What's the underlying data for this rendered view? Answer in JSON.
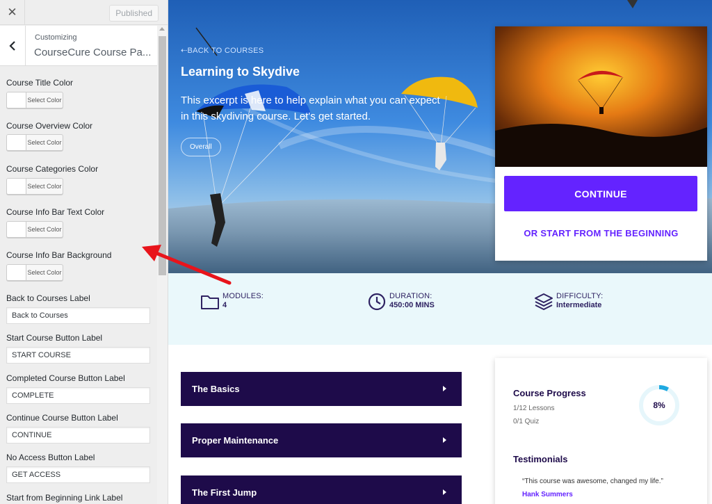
{
  "sidebar": {
    "close_icon": "close-icon",
    "published_label": "Published",
    "back_icon": "chevron-left-icon",
    "subtitle": "Customizing",
    "title": "CourseCure Course Pa...",
    "select_color_label": "Select Color",
    "color_controls": [
      {
        "label": "Course Title Color"
      },
      {
        "label": "Course Overview Color"
      },
      {
        "label": "Course Categories Color"
      },
      {
        "label": "Course Info Bar Text Color"
      },
      {
        "label": "Course Info Bar Background"
      }
    ],
    "text_controls": [
      {
        "label": "Back to Courses Label",
        "value": "Back to Courses"
      },
      {
        "label": "Start Course Button Label",
        "value": "START COURSE"
      },
      {
        "label": "Completed Course Button Label",
        "value": "COMPLETE"
      },
      {
        "label": "Continue Course Button Label",
        "value": "CONTINUE"
      },
      {
        "label": "No Access Button Label",
        "value": "GET ACCESS"
      },
      {
        "label": "Start from Beginning Link Label",
        "value": ""
      }
    ]
  },
  "hero": {
    "back_link": "BACK TO COURSES",
    "title": "Learning to Skydive",
    "excerpt": "This excerpt is here to help explain what you can expect in this skydiving course. Let's get started.",
    "pill": "Overall"
  },
  "card": {
    "continue_label": "CONTINUE",
    "restart_label": "OR START FROM THE BEGINNING"
  },
  "info_bar": {
    "modules_label": "MODULES:",
    "modules_value": "4",
    "duration_label": "DURATION:",
    "duration_value": "450:00 MINS",
    "difficulty_label": "DIFFICULTY:",
    "difficulty_value": "Intermediate"
  },
  "modules": [
    {
      "title": "The Basics"
    },
    {
      "title": "Proper Maintenance"
    },
    {
      "title": "The First Jump"
    }
  ],
  "progress": {
    "title": "Course Progress",
    "lessons": "1/12 Lessons",
    "quiz": "0/1 Quiz",
    "percent_label": "8%",
    "percent": 0.08,
    "testimonials_title": "Testimonials",
    "quote": "“This course was awesome, changed my life.”",
    "author": "Hank Summers"
  },
  "colors": {
    "accent": "#6423ff",
    "module_bg": "#1e0b4a",
    "info_bar_bg": "#eaf8fb",
    "annotation_arrow": "#e8141b"
  }
}
